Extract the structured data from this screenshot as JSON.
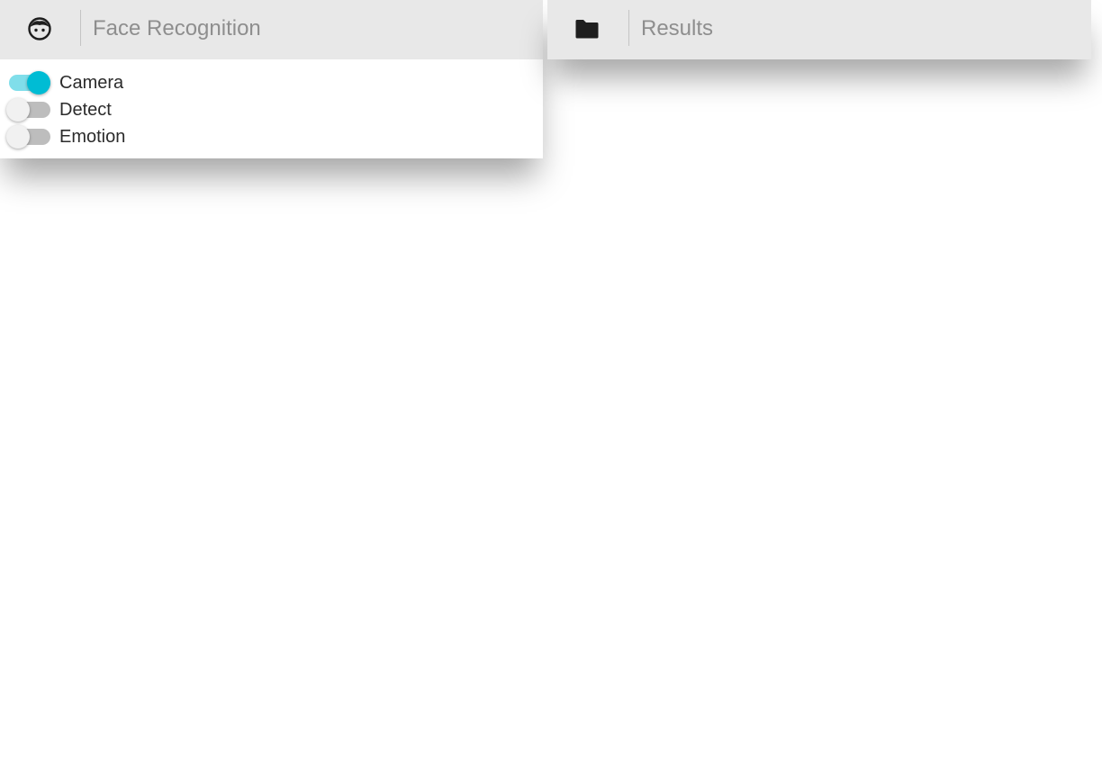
{
  "left_panel": {
    "header": {
      "icon": "face-icon",
      "title": "Face Recognition"
    },
    "toggles": [
      {
        "label": "Camera",
        "checked": true
      },
      {
        "label": "Detect",
        "checked": false
      },
      {
        "label": "Emotion",
        "checked": false
      }
    ]
  },
  "right_panel": {
    "header": {
      "icon": "folder-icon",
      "title": "Results"
    }
  },
  "colors": {
    "accent": "#00bcd4",
    "accent_track": "#80deea",
    "header_bg": "#e8e8e8",
    "title_text": "#8e8e8e"
  }
}
